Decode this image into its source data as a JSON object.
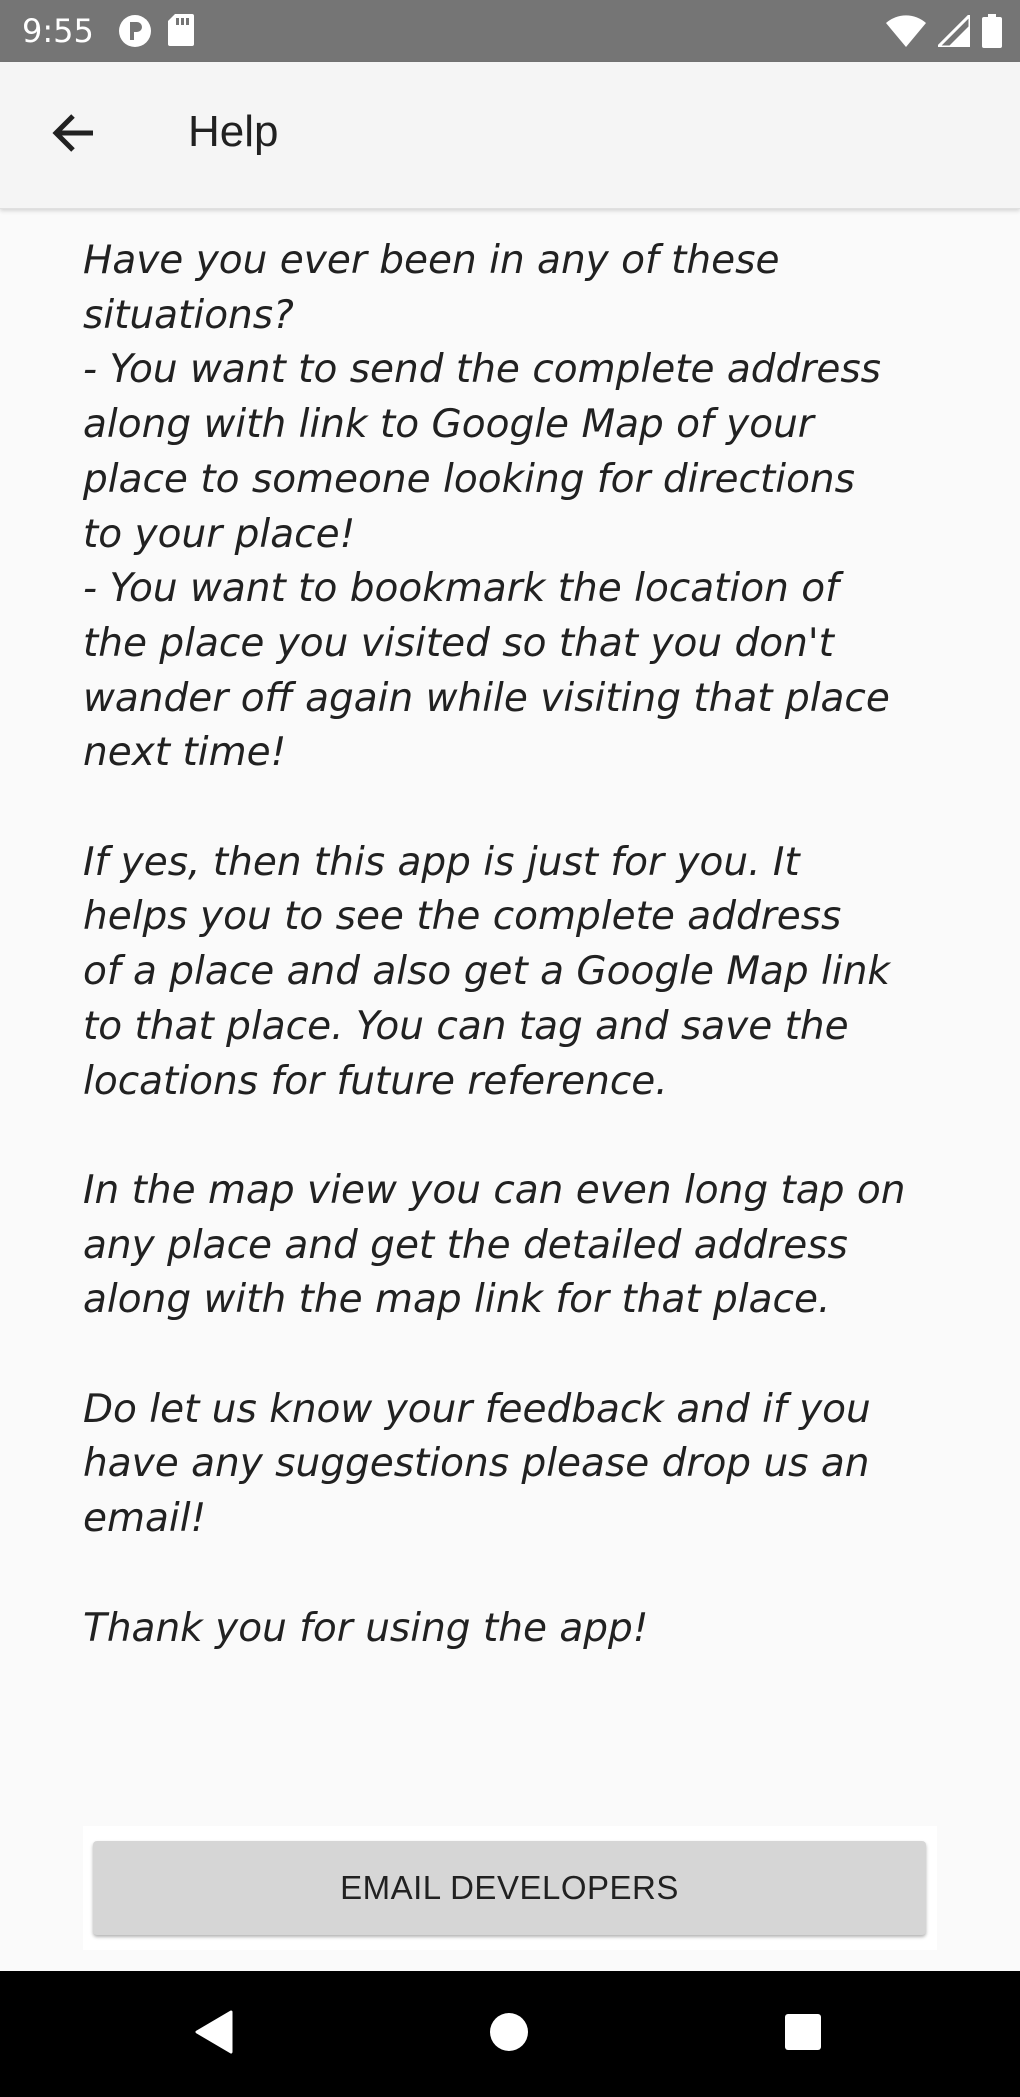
{
  "status_bar": {
    "time": "9:55",
    "left_icons": [
      "notification-p-icon",
      "sd-card-icon"
    ],
    "right_icons": [
      "wifi-icon",
      "cell-signal-icon",
      "battery-icon"
    ]
  },
  "app_bar": {
    "back_icon": "arrow-back-icon",
    "title": "Help"
  },
  "content": {
    "text": "Have you ever been in any of these\nsituations?\n- You want to send the complete address\nalong with link to Google Map of your\nplace to someone looking for directions\nto your place!\n- You want to bookmark the location of\nthe place you visited so that you don't\nwander off again while visiting that place\nnext time!\n\nIf yes, then this app is just for you. It\nhelps you to see the complete address\nof a place and also get a Google Map link\nto that place. You can tag and save the\nlocations for future reference.\n\nIn the map view you can even long tap on\nany place and get the detailed address\nalong with the map link for that place.\n\nDo let us know your feedback and if you\nhave any suggestions please drop us an\nemail!\n\nThank you for using the app!"
  },
  "actions": {
    "email_button_label": "EMAIL DEVELOPERS"
  },
  "nav_bar": {
    "buttons": [
      "back-triangle-icon",
      "home-circle-icon",
      "recents-square-icon"
    ]
  },
  "colors": {
    "status_bar": "#757575",
    "app_bar": "#f5f5f5",
    "background": "#fafafa",
    "button": "#d6d6d6",
    "nav_bar": "#000000"
  }
}
